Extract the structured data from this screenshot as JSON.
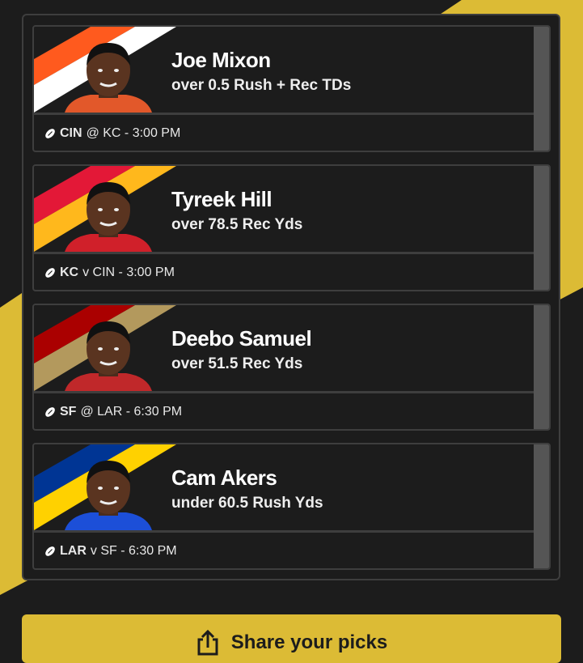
{
  "colors": {
    "background": "#1c1c1c",
    "accent_yellow": "#dcbb35",
    "card_border": "#3e3e3e"
  },
  "picks": [
    {
      "player": "Joe Mixon",
      "prop": "over 0.5 Rush + Rec TDs",
      "team": "CIN",
      "matchup": "@ KC - 3:00 PM",
      "jersey_color": "#e2582a",
      "stripe_colors": [
        "#ff5a1e",
        "#ffffff",
        "#1c1c1c"
      ]
    },
    {
      "player": "Tyreek Hill",
      "prop": "over 78.5 Rec Yds",
      "team": "KC",
      "matchup": "v CIN - 3:00 PM",
      "jersey_color": "#d0202a",
      "stripe_colors": [
        "#e31837",
        "#ffb81c",
        "#1c1c1c"
      ]
    },
    {
      "player": "Deebo Samuel",
      "prop": "over 51.5 Rec Yds",
      "team": "SF",
      "matchup": "@ LAR - 6:30 PM",
      "jersey_color": "#c0282a",
      "stripe_colors": [
        "#aa0000",
        "#b3995d",
        "#1c1c1c"
      ]
    },
    {
      "player": "Cam Akers",
      "prop": "under 60.5 Rush Yds",
      "team": "LAR",
      "matchup": "v SF - 6:30 PM",
      "jersey_color": "#1c4fd8",
      "stripe_colors": [
        "#003594",
        "#ffd100",
        "#1c1c1c"
      ]
    }
  ],
  "share_button": {
    "label": "Share your picks",
    "icon": "share-icon"
  }
}
